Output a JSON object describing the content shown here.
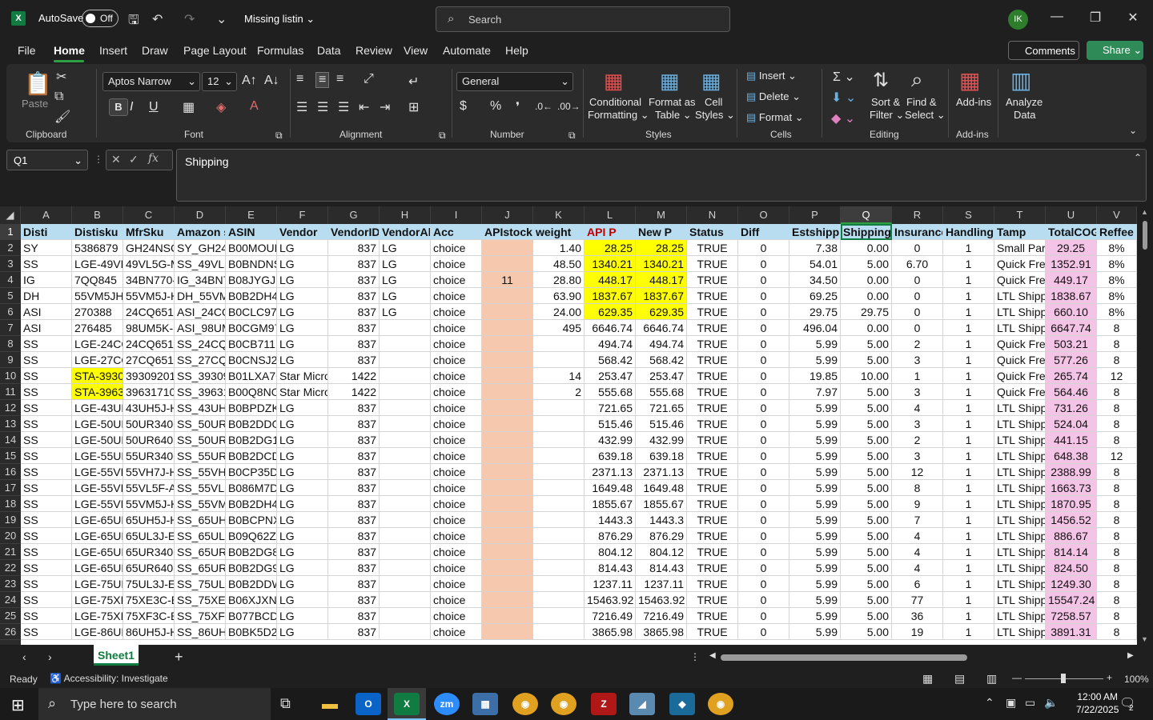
{
  "titlebar": {
    "autosave_label": "AutoSave",
    "toggle_state": "Off",
    "doc_title": "Missing listin",
    "search_placeholder": "Search",
    "avatar_initials": "IK"
  },
  "menu": [
    "File",
    "Home",
    "Insert",
    "Draw",
    "Page Layout",
    "Formulas",
    "Data",
    "Review",
    "View",
    "Automate",
    "Help"
  ],
  "menu_active": "Home",
  "comments_label": "Comments",
  "share_label": "Share",
  "ribbon": {
    "clipboard": {
      "label": "Clipboard",
      "paste": "Paste"
    },
    "font": {
      "label": "Font",
      "font_name": "Aptos Narrow",
      "font_size": "12"
    },
    "alignment": {
      "label": "Alignment"
    },
    "number": {
      "label": "Number",
      "format": "General"
    },
    "styles": {
      "label": "Styles",
      "conditional": "Conditional",
      "formatting": "Formatting",
      "format_as": "Format as",
      "table": "Table",
      "cell": "Cell",
      "styles_btn": "Styles"
    },
    "cells": {
      "label": "Cells",
      "insert": "Insert",
      "delete": "Delete",
      "format": "Format"
    },
    "editing": {
      "label": "Editing",
      "sort": "Sort &",
      "filter": "Filter",
      "find": "Find &",
      "select": "Select"
    },
    "addins": {
      "label": "Add-ins",
      "addins_btn": "Add-ins",
      "analyze": "Analyze",
      "data": "Data"
    }
  },
  "formula_bar": {
    "name_box": "Q1",
    "content": "Shipping"
  },
  "columns": [
    "A",
    "B",
    "C",
    "D",
    "E",
    "F",
    "G",
    "H",
    "I",
    "J",
    "K",
    "L",
    "M",
    "N",
    "O",
    "P",
    "Q",
    "R",
    "S",
    "T",
    "U",
    "V"
  ],
  "selected_column": "Q",
  "header_row": [
    "Disti",
    "Distisku",
    "MfrSku",
    "Amazon s",
    "ASIN",
    "Vendor",
    "VendorID",
    "VendorAl",
    "Acc",
    "APIstock",
    "weight",
    "API P",
    "New P",
    "Status",
    "Diff",
    "Estshipp",
    "Shipping",
    "Insurance",
    "Handling",
    "Tamp",
    "TotalCOG",
    "Reffee"
  ],
  "rows": [
    [
      "SY",
      "5386879",
      "GH24NSC0",
      "SY_GH24N",
      "B00MOUB",
      "LG",
      "837",
      "LG",
      "choice",
      "",
      "1.40",
      "28.25",
      "28.25",
      "TRUE",
      "0",
      "7.38",
      "0.00",
      "0",
      "1",
      "Small Parc",
      "29.25",
      "8%"
    ],
    [
      "SS",
      "LGE-49VL5",
      "49VL5G-M",
      "SS_49VL5G",
      "B0BNDNS",
      "LG",
      "837",
      "LG",
      "choice",
      "",
      "48.50",
      "1340.21",
      "1340.21",
      "TRUE",
      "0",
      "54.01",
      "5.00",
      "6.70",
      "1",
      "Quick Free",
      "1352.91",
      "8%"
    ],
    [
      "IG",
      "7QQ845",
      "34BN770-B",
      "IG_34BN77",
      "B08JYGJP3",
      "LG",
      "837",
      "LG",
      "choice",
      "11",
      "28.80",
      "448.17",
      "448.17",
      "TRUE",
      "0",
      "34.50",
      "0.00",
      "0",
      "1",
      "Quick Free",
      "449.17",
      "8%"
    ],
    [
      "DH",
      "55VM5JH",
      "55VM5J-H",
      "DH_55VM5",
      "B0B2DH4Y",
      "LG",
      "837",
      "LG",
      "choice",
      "",
      "63.90",
      "1837.67",
      "1837.67",
      "TRUE",
      "0",
      "69.25",
      "0.00",
      "0",
      "1",
      "LTL Shippi",
      "1838.67",
      "8%"
    ],
    [
      "ASI",
      "270388",
      "24CQ651W",
      "ASI_24CQ6",
      "B0CLC973I",
      "LG",
      "837",
      "LG",
      "choice",
      "",
      "24.00",
      "629.35",
      "629.35",
      "TRUE",
      "0",
      "29.75",
      "29.75",
      "0",
      "1",
      "LTL Shippi",
      "660.10",
      "8%"
    ],
    [
      "ASI",
      "276485",
      "98UM5K-B",
      "ASI_98UM",
      "B0CGM97V",
      "LG",
      "837",
      "",
      "choice",
      "",
      "495",
      "6646.74",
      "6646.74",
      "TRUE",
      "0",
      "496.04",
      "0.00",
      "0",
      "1",
      "LTL Shippi",
      "6647.74",
      "8"
    ],
    [
      "SS",
      "LGE-24CQ",
      "24CQ651N",
      "SS_24CQ6",
      "B0CB711K",
      "LG",
      "837",
      "",
      "choice",
      "",
      "",
      "494.74",
      "494.74",
      "TRUE",
      "0",
      "5.99",
      "5.00",
      "2",
      "1",
      "Quick Free",
      "503.21",
      "8"
    ],
    [
      "SS",
      "LGE-27CQ",
      "27CQ651N",
      "SS_27CQ6",
      "B0CNSJ2T",
      "LG",
      "837",
      "",
      "choice",
      "",
      "",
      "568.42",
      "568.42",
      "TRUE",
      "0",
      "5.99",
      "5.00",
      "3",
      "1",
      "Quick Free",
      "577.26",
      "8"
    ],
    [
      "SS",
      "STA-39309",
      "39309201",
      "SS_393092",
      "B01LXA76",
      "Star Micro",
      "1422",
      "",
      "choice",
      "",
      "14",
      "253.47",
      "253.47",
      "TRUE",
      "0",
      "19.85",
      "10.00",
      "1",
      "1",
      "Quick Free",
      "265.74",
      "12"
    ],
    [
      "SS",
      "STA-39631",
      "39631710",
      "SS_396317",
      "B00Q8NO",
      "Star Micro",
      "1422",
      "",
      "choice",
      "",
      "2",
      "555.68",
      "555.68",
      "TRUE",
      "0",
      "7.97",
      "5.00",
      "3",
      "1",
      "Quick Free",
      "564.46",
      "8"
    ],
    [
      "SS",
      "LGE-43UH",
      "43UH5J-H",
      "SS_43UH5",
      "B0BPDZKP",
      "LG",
      "837",
      "",
      "choice",
      "",
      "",
      "721.65",
      "721.65",
      "TRUE",
      "0",
      "5.99",
      "5.00",
      "4",
      "1",
      "LTL Shippi",
      "731.26",
      "8"
    ],
    [
      "SS",
      "LGE-50UR",
      "50UR340C",
      "SS_50UR34",
      "B0B2DDGT",
      "LG",
      "837",
      "",
      "choice",
      "",
      "",
      "515.46",
      "515.46",
      "TRUE",
      "0",
      "5.99",
      "5.00",
      "3",
      "1",
      "LTL Shippi",
      "524.04",
      "8"
    ],
    [
      "SS",
      "LGE-50UR",
      "50UR640S",
      "SS_50UR64",
      "B0B2DG1Z",
      "LG",
      "837",
      "",
      "choice",
      "",
      "",
      "432.99",
      "432.99",
      "TRUE",
      "0",
      "5.99",
      "5.00",
      "2",
      "1",
      "LTL Shippi",
      "441.15",
      "8"
    ],
    [
      "SS",
      "LGE-55UR",
      "55UR340C",
      "SS_55UR34",
      "B0B2DCDK",
      "LG",
      "837",
      "",
      "choice",
      "",
      "",
      "639.18",
      "639.18",
      "TRUE",
      "0",
      "5.99",
      "5.00",
      "3",
      "1",
      "LTL Shippi",
      "648.38",
      "12"
    ],
    [
      "SS",
      "LGE-55VH",
      "55VH7J-H",
      "SS_55VH7J",
      "B0CP35D4",
      "LG",
      "837",
      "",
      "choice",
      "",
      "",
      "2371.13",
      "2371.13",
      "TRUE",
      "0",
      "5.99",
      "5.00",
      "12",
      "1",
      "LTL Shippi",
      "2388.99",
      "8"
    ],
    [
      "SS",
      "LGE-55VL5",
      "55VL5F-A",
      "SS_55VL5F",
      "B086M7DN",
      "LG",
      "837",
      "",
      "choice",
      "",
      "",
      "1649.48",
      "1649.48",
      "TRUE",
      "0",
      "5.99",
      "5.00",
      "8",
      "1",
      "LTL Shippi",
      "1663.73",
      "8"
    ],
    [
      "SS",
      "LGE-55VM",
      "55VM5J-H",
      "SS_55VM5",
      "B0B2DH4Y",
      "LG",
      "837",
      "",
      "choice",
      "",
      "",
      "1855.67",
      "1855.67",
      "TRUE",
      "0",
      "5.99",
      "5.00",
      "9",
      "1",
      "LTL Shippi",
      "1870.95",
      "8"
    ],
    [
      "SS",
      "LGE-65UH",
      "65UH5J-H",
      "SS_65UH5",
      "B0BCPNXN",
      "LG",
      "837",
      "",
      "choice",
      "",
      "",
      "1443.3",
      "1443.3",
      "TRUE",
      "0",
      "5.99",
      "5.00",
      "7",
      "1",
      "LTL Shippi",
      "1456.52",
      "8"
    ],
    [
      "SS",
      "LGE-65UL",
      "65UL3J-E",
      "SS_65UL3J",
      "B09Q62ZB",
      "LG",
      "837",
      "",
      "choice",
      "",
      "",
      "876.29",
      "876.29",
      "TRUE",
      "0",
      "5.99",
      "5.00",
      "4",
      "1",
      "LTL Shippi",
      "886.67",
      "8"
    ],
    [
      "SS",
      "LGE-65UR",
      "65UR340C",
      "SS_65UR34",
      "B0B2DG8P",
      "LG",
      "837",
      "",
      "choice",
      "",
      "",
      "804.12",
      "804.12",
      "TRUE",
      "0",
      "5.99",
      "5.00",
      "4",
      "1",
      "LTL Shippi",
      "814.14",
      "8"
    ],
    [
      "SS",
      "LGE-65UR",
      "65UR640S",
      "SS_65UR64",
      "B0B2DG97",
      "LG",
      "837",
      "",
      "choice",
      "",
      "",
      "814.43",
      "814.43",
      "TRUE",
      "0",
      "5.99",
      "5.00",
      "4",
      "1",
      "LTL Shippi",
      "824.50",
      "8"
    ],
    [
      "SS",
      "LGE-75UL",
      "75UL3J-E",
      "SS_75UL3J",
      "B0B2DDW",
      "LG",
      "837",
      "",
      "choice",
      "",
      "",
      "1237.11",
      "1237.11",
      "TRUE",
      "0",
      "5.99",
      "5.00",
      "6",
      "1",
      "LTL Shippi",
      "1249.30",
      "8"
    ],
    [
      "SS",
      "LGE-75XE",
      "75XE3C-B",
      "SS_75XE3C",
      "B06XJXN7",
      "LG",
      "837",
      "",
      "choice",
      "",
      "",
      "15463.92",
      "15463.92",
      "TRUE",
      "0",
      "5.99",
      "5.00",
      "77",
      "1",
      "LTL Shippi",
      "15547.24",
      "8"
    ],
    [
      "SS",
      "LGE-75XF",
      "75XF3C-B",
      "SS_75XF3C",
      "B077BCDG",
      "LG",
      "837",
      "",
      "choice",
      "",
      "",
      "7216.49",
      "7216.49",
      "TRUE",
      "0",
      "5.99",
      "5.00",
      "36",
      "1",
      "LTL Shippi",
      "7258.57",
      "8"
    ],
    [
      "SS",
      "LGE-86UH",
      "86UH5J-H",
      "SS_86UH5",
      "B0BK5D2L",
      "LG",
      "837",
      "",
      "choice",
      "",
      "",
      "3865.98",
      "3865.98",
      "TRUE",
      "0",
      "5.99",
      "5.00",
      "19",
      "1",
      "LTL Shippi",
      "3891.31",
      "8"
    ]
  ],
  "yellow_cells": [
    "1-11",
    "1-12",
    "2-11",
    "2-12",
    "3-11",
    "3-12",
    "4-11",
    "4-12",
    "5-11",
    "5-12",
    "9-1",
    "10-1"
  ],
  "sheet_tab": "Sheet1",
  "status": {
    "ready": "Ready",
    "accessibility": "Accessibility: Investigate",
    "zoom": "100%"
  },
  "taskbar": {
    "search_placeholder": "Type here to search",
    "time": "12:00 AM",
    "date": "7/22/2025",
    "notif_count": "2"
  },
  "colors": {
    "excel_green": "#107c41",
    "header_fill": "#b8dcf0",
    "highlight_yellow": "#ffff00",
    "peach": "#f6c8ae",
    "pink": "#f4c4e6"
  }
}
